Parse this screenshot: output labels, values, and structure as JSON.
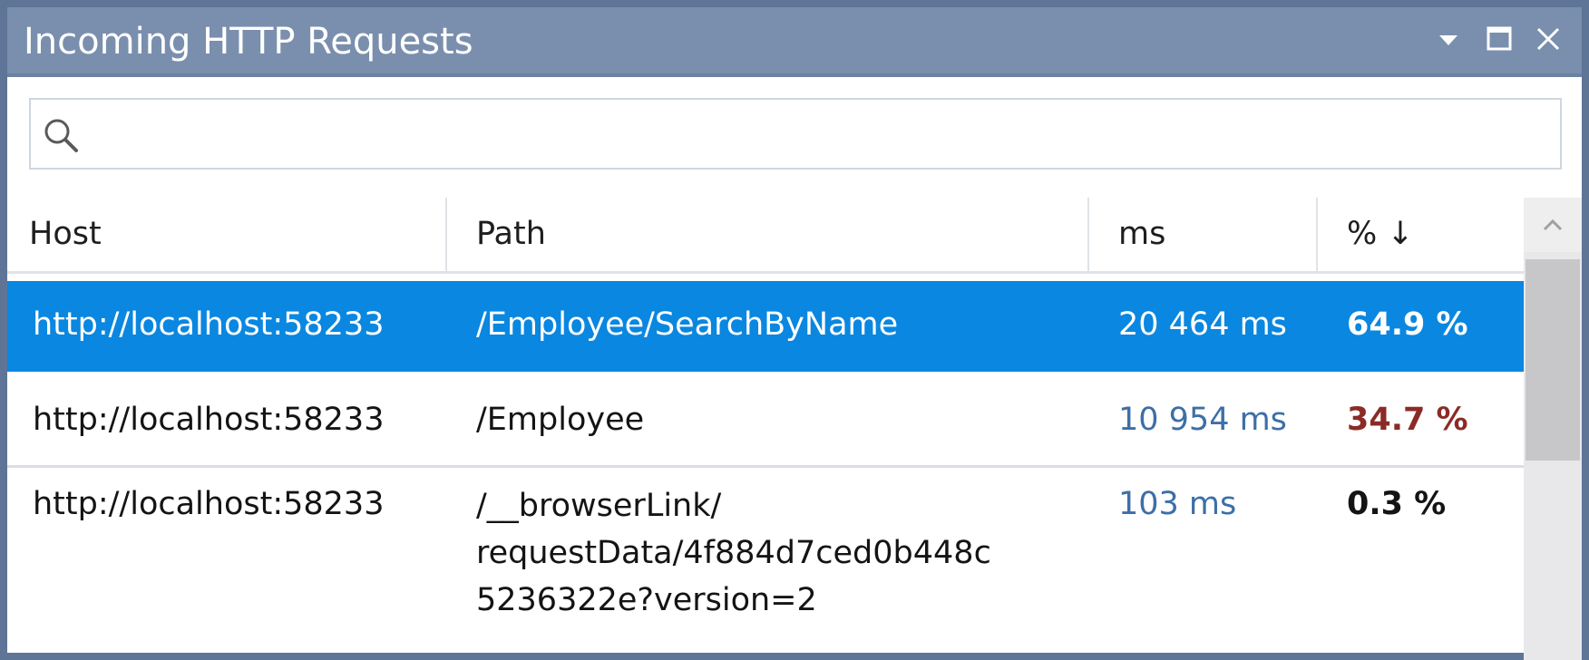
{
  "window": {
    "title": "Incoming HTTP Requests",
    "controls": [
      "chevron-down-icon",
      "maximize-icon",
      "close-icon"
    ]
  },
  "search": {
    "placeholder": "",
    "value": ""
  },
  "table": {
    "columns": [
      "Host",
      "Path",
      "ms",
      "% ↓"
    ],
    "sort": {
      "column": "%",
      "direction": "descending"
    },
    "rows": [
      {
        "host": "http://localhost:58233",
        "path": "/Employee/SearchByName",
        "ms": "20 464 ms",
        "pct": "64.9 %",
        "selected": true
      },
      {
        "host": "http://localhost:58233",
        "path": "/Employee",
        "ms": "10 954 ms",
        "pct": "34.7 %",
        "selected": false
      },
      {
        "host": "http://localhost:58233",
        "path_lines": [
          "/__browserLink/",
          "requestData/4f884d7ced0b448c",
          "5236322e?version=2"
        ],
        "ms": "103 ms",
        "pct": "0.3 %",
        "selected": false
      }
    ]
  },
  "colors": {
    "titlebar": "#7a8fad",
    "frame": "#5f7597",
    "selection": "#0a87e0",
    "ms_text": "#3d6fa6",
    "high_pct_text": "#8b2b26"
  }
}
